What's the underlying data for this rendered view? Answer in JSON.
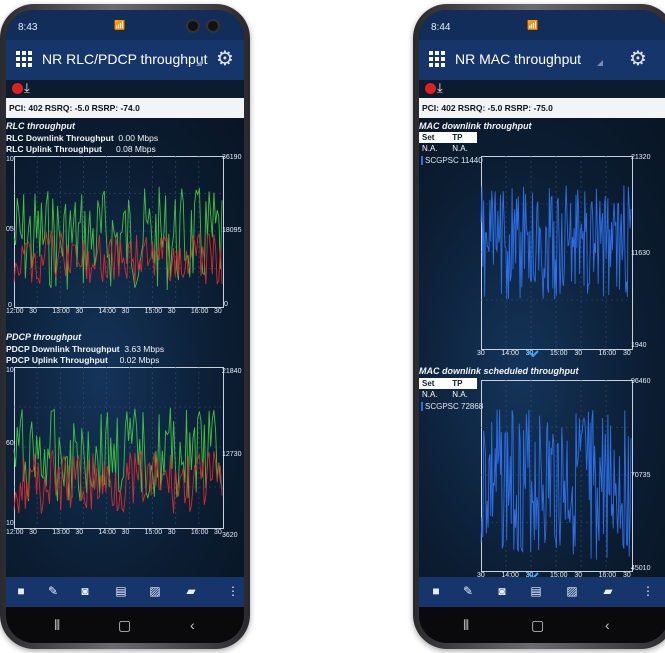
{
  "left": {
    "time": "8:43",
    "title": "NR RLC/PDCP throughput",
    "info": "PCI: 402  RSRQ: -5.0  RSRP: -74.0",
    "rlc": {
      "section": "RLC throughput",
      "dl_label": "RLC Downlink Throughput",
      "dl_value": "0.00 Mbps",
      "ul_label": "RLC Uplink Throughput",
      "ul_value": "0.08 Mbps",
      "left_ticks": [
        "10",
        "05",
        "0"
      ],
      "right_ticks": [
        "36190",
        "18095",
        "0"
      ],
      "x_ticks": [
        "12:00",
        "30",
        "13:00",
        "30",
        "14:00",
        "30",
        "15:00",
        "30",
        "16:00",
        "30"
      ]
    },
    "pdcp": {
      "section": "PDCP throughput",
      "dl_label": "PDCP Downlink Throughput",
      "dl_value": "3.63 Mbps",
      "ul_label": "PDCP Uplink Throughput",
      "ul_value": "0.02 Mbps",
      "left_ticks": [
        "10",
        "60",
        "10"
      ],
      "right_ticks": [
        "21840",
        "12730",
        "3620"
      ],
      "x_ticks": [
        "12:00",
        "30",
        "13:00",
        "30",
        "14:00",
        "30",
        "15:00",
        "30",
        "16:00",
        "30"
      ]
    }
  },
  "right": {
    "time": "8:44",
    "title": "NR MAC throughput",
    "info": "PCI: 402  RSRQ: -5.0  RSRP: -75.0",
    "mac": {
      "section": "MAC downlink throughput",
      "table_headers": [
        "Set",
        "TP"
      ],
      "table_row": [
        "N.A.",
        "N.A."
      ],
      "legend": "SCGPSC 11440",
      "right_ticks": [
        "21320",
        "11630",
        "1940"
      ],
      "x_ticks": [
        "30",
        "14:00",
        "30",
        "15:00",
        "30",
        "16:00",
        "30"
      ]
    },
    "sched": {
      "section": "MAC downlink scheduled throughput",
      "table_headers": [
        "Set",
        "TP"
      ],
      "table_row": [
        "N.A.",
        "N.A."
      ],
      "legend": "SCGPSC 72868",
      "right_ticks": [
        "96460",
        "70735",
        "45010"
      ],
      "x_ticks": [
        "30",
        "14:00",
        "30",
        "15:00",
        "30",
        "16:00",
        "30"
      ]
    }
  },
  "colors": {
    "green": "#3fc23f",
    "red": "#d92a2a",
    "blue": "#2c6fe6",
    "appbar": "#16356a"
  }
}
